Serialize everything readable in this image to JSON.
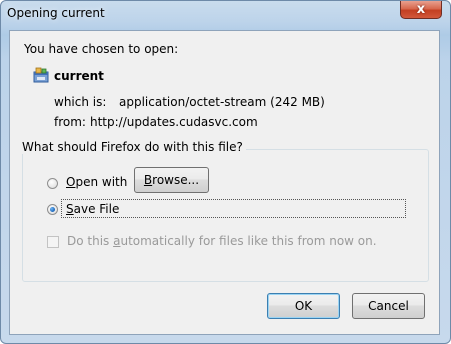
{
  "window": {
    "title": "Opening current",
    "close_glyph": "x"
  },
  "intro": "You have chosen to open:",
  "file": {
    "name": "current",
    "icon": "application-file-icon",
    "type_label": "which is:",
    "type_value": "application/octet-stream (242 MB)",
    "from_label": "from:",
    "from_value": "http://updates.cudasvc.com"
  },
  "action_group": {
    "legend": "What should Firefox do with this file?",
    "open_with": {
      "prefix": "",
      "mnemonic": "O",
      "rest": "pen with",
      "selected": false
    },
    "browse_button": {
      "mnemonic": "B",
      "rest": "rowse..."
    },
    "save_file": {
      "mnemonic": "S",
      "rest": "ave File",
      "selected": true
    },
    "auto": {
      "before": "Do this ",
      "mnemonic": "a",
      "after": "utomatically for files like this from now on.",
      "checked": false,
      "enabled": false
    }
  },
  "buttons": {
    "ok": "OK",
    "cancel": "Cancel"
  },
  "colors": {
    "accent": "#3c7fb1",
    "close": "#c33f22"
  }
}
